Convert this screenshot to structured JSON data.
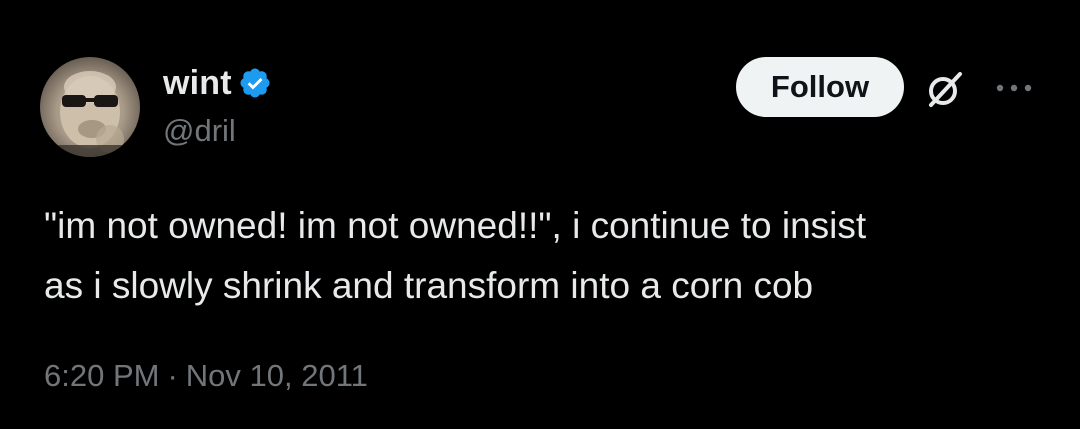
{
  "author": {
    "display_name": "wint",
    "handle": "@dril",
    "verified": true,
    "verified_color": "#1d9bf0"
  },
  "actions": {
    "follow_label": "Follow",
    "grok_icon": "grok-icon",
    "more_icon": "more-icon"
  },
  "tweet": {
    "text_lines": [
      "\"im not owned!  im not owned!!\", i continue to insist",
      "as i slowly shrink and transform into a corn cob"
    ]
  },
  "meta": {
    "time": "6:20 PM",
    "separator": "·",
    "date": "Nov 10, 2011"
  },
  "colors": {
    "background": "#000000",
    "text": "#e7e9ea",
    "secondary_text": "#71767b",
    "follow_bg": "#eff3f4"
  }
}
